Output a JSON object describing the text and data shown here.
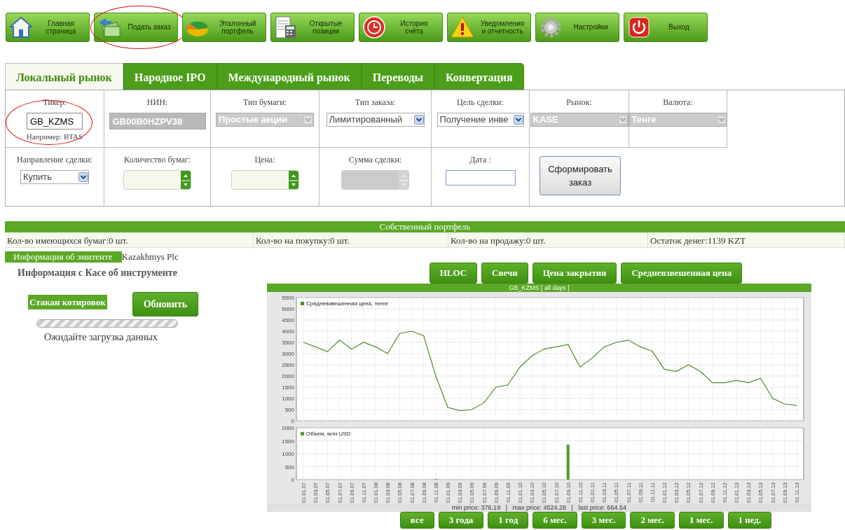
{
  "toolbar": [
    {
      "kind": "home",
      "label": "Главная\nстраница",
      "highlighted": false
    },
    {
      "kind": "order",
      "label": "Подать заказ",
      "highlighted": true
    },
    {
      "kind": "portfolio",
      "label": "Эталонный\nпортфель",
      "highlighted": false
    },
    {
      "kind": "positions",
      "label": "Открытые\nпозиции",
      "highlighted": false
    },
    {
      "kind": "history",
      "label": "История\nсчёта",
      "highlighted": false
    },
    {
      "kind": "alerts",
      "label": "Уведомления\nи отчетность",
      "highlighted": false
    },
    {
      "kind": "settings",
      "label": "Настройки",
      "highlighted": false
    },
    {
      "kind": "exit",
      "label": "Выход",
      "highlighted": false
    }
  ],
  "tabs": [
    {
      "label": "Локальный рынок",
      "selected": true
    },
    {
      "label": "Народное IPO",
      "selected": false
    },
    {
      "label": "Международный рынок",
      "selected": false
    },
    {
      "label": "Переводы",
      "selected": false
    },
    {
      "label": "Конвертация",
      "selected": false
    }
  ],
  "form": {
    "rows": [
      [
        {
          "kind": "text",
          "label": "Тикер:",
          "value": "GB_KZMS",
          "note": "Например: BTAS",
          "disabled": false,
          "highlighted": true
        },
        {
          "kind": "text",
          "label": "НИН:",
          "value": "GB00B0HZPV38",
          "disabled": true
        },
        {
          "kind": "select",
          "label": "Тип бумаги:",
          "value": "Простые акции",
          "disabled": true
        },
        {
          "kind": "select",
          "label": "Тип заказа:",
          "value": "Лимитированный",
          "disabled": false
        },
        {
          "kind": "select",
          "label": "Цель сделки:",
          "value": "Получение инве",
          "disabled": false
        },
        {
          "kind": "select",
          "label": "Рынок:",
          "value": "KASE",
          "disabled": true
        },
        {
          "kind": "select",
          "label": "Валюта:",
          "value": "Тенге",
          "disabled": true
        }
      ],
      [
        {
          "kind": "select",
          "label": "Направление сделки:",
          "value": "Купить",
          "disabled": false
        },
        {
          "kind": "spinner",
          "label": "Количество бумаг:",
          "disabled": false
        },
        {
          "kind": "spinner",
          "label": "Цена:",
          "disabled": false
        },
        {
          "kind": "spinner",
          "label": "Сумма сделки:",
          "disabled": true
        },
        {
          "kind": "date",
          "label": "Дата :"
        },
        {
          "kind": "button",
          "label": "Сформировать заказ"
        }
      ]
    ]
  },
  "portfolio": {
    "title": "Собственный портфель",
    "cells": [
      "Кол-во имеющихся бумаг:0 шт.",
      "Кол-во на покупку:0 шт.",
      "Кол-во на продажу:0 шт.",
      "Остаток денег:1139 KZT"
    ]
  },
  "issuer": {
    "tab": "Информация об эмитенте",
    "name": "Kazakhmys Plc",
    "heading": "Информация с Касе об инструменте",
    "quotes_label": "Стакан котировок",
    "refresh_button": "Обновить",
    "loading_text": "Ожидайте загрузка данных"
  },
  "chart_buttons": [
    "HLOC",
    "Свечи",
    "Цена закрытия",
    "Средневзвешенная цена"
  ],
  "chart": {
    "title": "GB_KZMS [ all days ]",
    "price_chart": {
      "chart_data": {
        "type": "line",
        "grid": true,
        "ylim": [
          0,
          5500
        ],
        "yticks": [
          0,
          500,
          1000,
          1500,
          2000,
          2500,
          3000,
          3500,
          4000,
          4500,
          5000,
          5500
        ],
        "series": [
          {
            "name": "Средневзвешенная цена, тенге",
            "color": "#4f8a2a",
            "values": [
              3500,
              3300,
              3080,
              3600,
              3200,
              3500,
              3300,
              3000,
              3900,
              4000,
              3800,
              2000,
              600,
              450,
              500,
              800,
              1500,
              1600,
              2400,
              2900,
              3200,
              3300,
              3400,
              2400,
              2800,
              3300,
              3500,
              3600,
              3300,
              3100,
              2300,
              2200,
              2500,
              2200,
              1700,
              1700,
              1800,
              1700,
              1900,
              1000,
              750,
              680
            ]
          }
        ]
      }
    },
    "volume_chart": {
      "chart_data": {
        "type": "bar",
        "grid": true,
        "ylim": [
          0,
          2000
        ],
        "yticks": [
          0,
          500,
          1000,
          1500,
          2000
        ],
        "categories": [
          "01.01.07",
          "01.03.07",
          "01.05.07",
          "01.07.07",
          "01.09.07",
          "01.11.07",
          "01.01.08",
          "01.03.08",
          "01.05.08",
          "01.07.08",
          "01.09.08",
          "01.11.08",
          "01.01.09",
          "01.03.09",
          "01.05.09",
          "01.07.09",
          "01.09.09",
          "01.11.09",
          "01.01.10",
          "01.03.10",
          "01.05.10",
          "01.07.10",
          "01.09.10",
          "01.11.10",
          "01.01.11",
          "01.03.11",
          "01.05.11",
          "01.07.11",
          "01.09.11",
          "01.11.11",
          "01.01.12",
          "01.03.12",
          "01.05.12",
          "01.07.12",
          "01.09.12",
          "01.11.12",
          "01.01.13",
          "01.03.13",
          "01.05.13",
          "01.07.13",
          "01.09.13",
          "01.11.13"
        ],
        "series": [
          {
            "name": "Объем, млн USD",
            "color": "#4f9a2a",
            "values": [
              0,
              0,
              0,
              0,
              0,
              0,
              0,
              0,
              0,
              0,
              0,
              20,
              0,
              0,
              0,
              0,
              0,
              0,
              0,
              0,
              0,
              0,
              1350,
              0,
              0,
              0,
              0,
              0,
              0,
              0,
              0,
              0,
              0,
              0,
              0,
              0,
              0,
              0,
              0,
              0,
              0,
              0
            ]
          }
        ]
      }
    },
    "stats": "min price: 376.19   |   max price: 4524.28   |   last price: 664.54"
  },
  "periods": [
    "все",
    "3 года",
    "1 год",
    "6 мес.",
    "3 мес.",
    "2 мес.",
    "1 мес.",
    "1 нед."
  ]
}
